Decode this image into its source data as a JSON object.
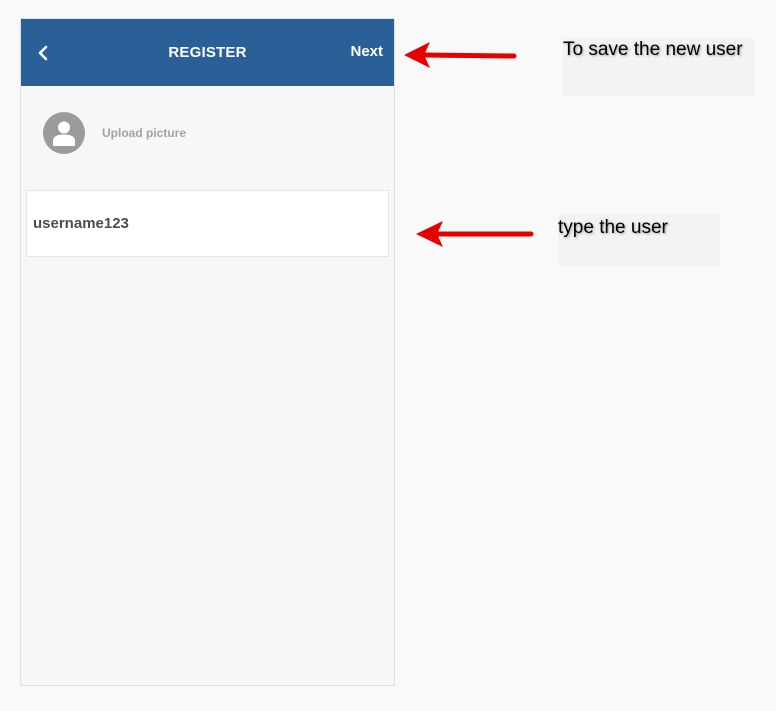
{
  "header": {
    "back_icon": "chevron-left-icon",
    "title": "REGISTER",
    "next_label": "Next",
    "background_color": "#2b5f97"
  },
  "upload": {
    "icon": "user-avatar-icon",
    "label": "Upload picture"
  },
  "username_input": {
    "value": "username123"
  },
  "annotations": {
    "save_note": "To save the new user",
    "type_note": "type the user",
    "arrow_color": "#e60000"
  }
}
